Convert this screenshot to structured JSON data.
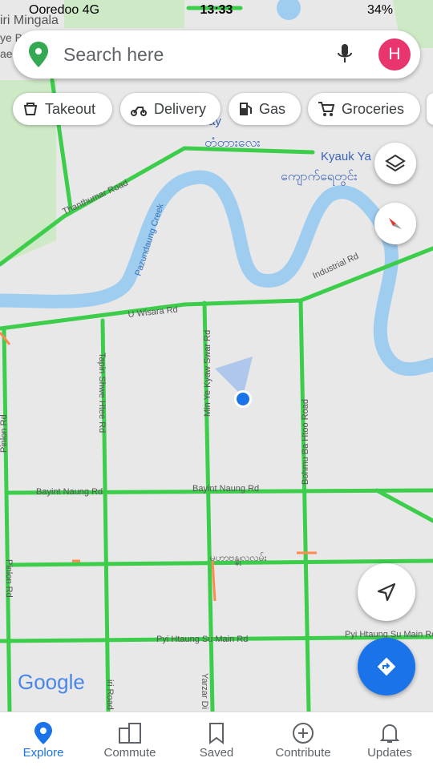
{
  "status": {
    "carrier": "Ooredoo  4G",
    "time": "13:33",
    "battery": "34%"
  },
  "search": {
    "placeholder": "Search here",
    "avatar_letter": "H"
  },
  "chips": [
    "Takeout",
    "Delivery",
    "Gas",
    "Groceries"
  ],
  "map_labels": {
    "top_left_1": "iri Mingala",
    "top_left_2": "ye B",
    "top_left_3": "ae",
    "kyauk_yadanar": "Kyauk Ya",
    "ay": "ay",
    "burmese_1": "တံတားလေး",
    "burmese_2": "ကျောက်ရေတွင်း",
    "thanthumar": "Thanthumar Road",
    "pazundaung": "Pazundaung Creek",
    "wisara": "U Wisara Rd",
    "industrial": "Industrial Rd",
    "tapin_shwe_htee": "Tapin Shwe Htee Rd",
    "min_ye_kyaw_swar": "Min Ye Kyaw Swar Rd",
    "bayint_naung_1": "Bayint Naung Rd",
    "bayint_naung_2": "Bayint Naung Rd",
    "bohmu_ba_htoo": "Bohmu Ba Htoo Road",
    "pinlon_1": "Pinlon Rd",
    "pinlon_2": "Pinlon Rd",
    "burmese_3": "မဟာဗန္ဓုလလမ်း",
    "pyi_htaung_su_1": "Pyi Htaung Su Main Rd",
    "pyi_htaung_su_2": "Pyi Htaung Su Main Rd",
    "yarzar": "Yarzar Di",
    "bottom_road": "iri Road"
  },
  "logo": "Google",
  "nav": {
    "items": [
      {
        "label": "Explore",
        "active": true
      },
      {
        "label": "Commute",
        "active": false
      },
      {
        "label": "Saved",
        "active": false
      },
      {
        "label": "Contribute",
        "active": false
      },
      {
        "label": "Updates",
        "active": false
      }
    ]
  },
  "colors": {
    "accent": "#1a73e8",
    "traffic_green": "#3ccd4a",
    "water": "#9fcdf0",
    "park": "#cde9c6"
  }
}
